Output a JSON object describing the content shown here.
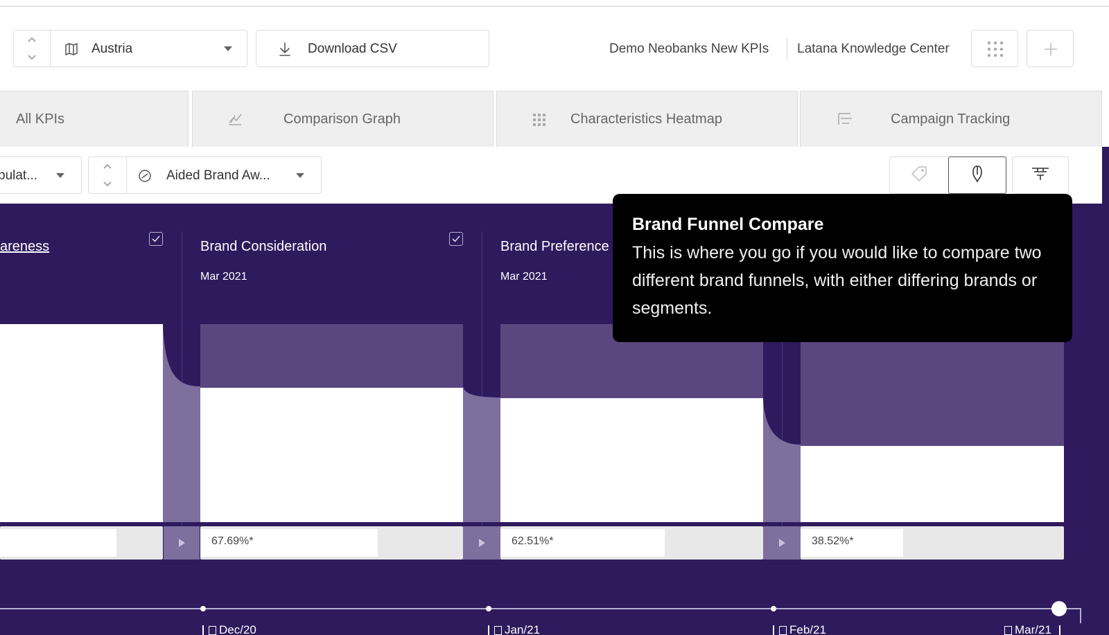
{
  "toolbar": {
    "country": "Austria",
    "download_label": "Download CSV",
    "project_link": "Demo Neobanks New KPIs",
    "knowledge_link": "Latana Knowledge Center"
  },
  "tabs": [
    {
      "label": "All KPIs",
      "icon": "none"
    },
    {
      "label": "Comparison Graph",
      "icon": "chart-line-icon"
    },
    {
      "label": "Characteristics Heatmap",
      "icon": "grid-icon"
    },
    {
      "label": "Campaign Tracking",
      "icon": "campaign-bars-icon"
    }
  ],
  "filters": {
    "population_label": "pulat...",
    "kpi_label": "Aided Brand Aw..."
  },
  "columns": [
    {
      "title": "areness",
      "date": "",
      "percent": "",
      "bar_level": 1.0
    },
    {
      "title": "Brand Consideration",
      "date": "Mar 2021",
      "percent": "67.69%*",
      "bar_level": 0.6769
    },
    {
      "title": "Brand Preference",
      "date": "Mar 2021",
      "percent": "62.51%*",
      "bar_level": 0.6251
    },
    {
      "title": "",
      "date": "",
      "percent": "38.52%*",
      "bar_level": 0.3852
    }
  ],
  "timeline": {
    "labels": [
      "Dec/20",
      "Jan/21",
      "Feb/21",
      "Mar/21"
    ]
  },
  "tooltip": {
    "title": "Brand Funnel Compare",
    "body": "This is where you go if you would like to compare two different brand funnels, with either differing brands or segments."
  },
  "colors": {
    "panel": "#2e1a5c",
    "bar_bg": "#5b477f",
    "connector": "#7e6f9e",
    "tooltip": "#000000"
  }
}
